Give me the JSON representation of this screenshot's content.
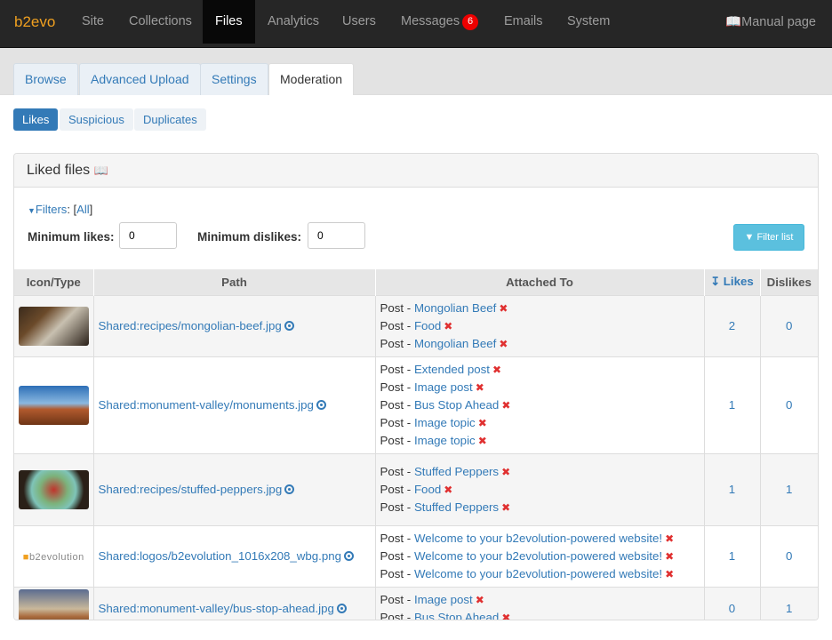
{
  "topbar": {
    "brand": "b2evo",
    "nav": [
      "Site",
      "Collections",
      "Files",
      "Analytics",
      "Users",
      "Messages",
      "Emails",
      "System"
    ],
    "messages_badge": "6",
    "manual": "Manual page"
  },
  "tabs": [
    "Browse",
    "Advanced Upload",
    "Settings",
    "Moderation"
  ],
  "subtabs": [
    "Likes",
    "Suspicious",
    "Duplicates"
  ],
  "panel": {
    "title": "Liked files",
    "filters_label": "Filters",
    "filters_all": "All",
    "min_likes_label": "Minimum likes:",
    "min_likes_value": "0",
    "min_dislikes_label": "Minimum dislikes:",
    "min_dislikes_value": "0",
    "filter_button": "Filter list"
  },
  "table": {
    "headers": [
      "Icon/Type",
      "Path",
      "Attached To",
      "Likes",
      "Dislikes"
    ],
    "rows": [
      {
        "path": "Shared:recipes/mongolian-beef.jpg",
        "attached": [
          [
            "Post",
            "Mongolian Beef"
          ],
          [
            "Post",
            "Food"
          ],
          [
            "Post",
            "Mongolian Beef"
          ]
        ],
        "likes": "2",
        "dislikes": "0"
      },
      {
        "path": "Shared:monument-valley/monuments.jpg",
        "attached": [
          [
            "Post",
            "Extended post"
          ],
          [
            "Post",
            "Image post"
          ],
          [
            "Post",
            "Bus Stop Ahead"
          ],
          [
            "Post",
            "Image topic"
          ],
          [
            "Post",
            "Image topic"
          ]
        ],
        "likes": "1",
        "dislikes": "0"
      },
      {
        "path": "Shared:recipes/stuffed-peppers.jpg",
        "attached": [
          [
            "Post",
            "Stuffed Peppers"
          ],
          [
            "Post",
            "Food"
          ],
          [
            "Post",
            "Stuffed Peppers"
          ]
        ],
        "likes": "1",
        "dislikes": "1"
      },
      {
        "path": "Shared:logos/b2evolution_1016x208_wbg.png",
        "attached": [
          [
            "Post",
            "Welcome to your b2evolution-powered website!"
          ],
          [
            "Post",
            "Welcome to your b2evolution-powered website!"
          ],
          [
            "Post",
            "Welcome to your b2evolution-powered website!"
          ]
        ],
        "likes": "1",
        "dislikes": "0"
      },
      {
        "path": "Shared:monument-valley/bus-stop-ahead.jpg",
        "attached": [
          [
            "Post",
            "Image post"
          ],
          [
            "Post",
            "Bus Stop Ahead"
          ]
        ],
        "likes": "0",
        "dislikes": "1"
      }
    ]
  },
  "logo_text": "b2evolution"
}
